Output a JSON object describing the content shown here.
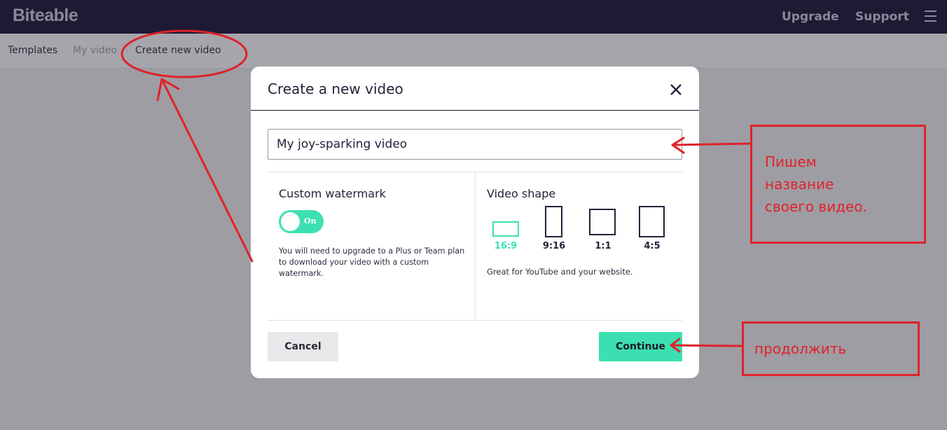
{
  "header": {
    "logo": "Biteable",
    "upgrade_label": "Upgrade",
    "support_label": "Support"
  },
  "subnav": {
    "items": [
      {
        "label": "Templates"
      },
      {
        "label": "My video"
      },
      {
        "label": "Create new video"
      }
    ]
  },
  "modal": {
    "title": "Create a new video",
    "name_input_value": "My joy-sparking video",
    "watermark": {
      "title": "Custom watermark",
      "toggle_label": "On",
      "toggle_state": "on",
      "note": "You will need to upgrade to a Plus or Team plan to download your video with a custom watermark."
    },
    "shape": {
      "title": "Video shape",
      "options": [
        {
          "label": "16:9",
          "selected": true
        },
        {
          "label": "9:16",
          "selected": false
        },
        {
          "label": "1:1",
          "selected": false
        },
        {
          "label": "4:5",
          "selected": false
        }
      ],
      "description": "Great for YouTube and your website."
    },
    "cancel_label": "Cancel",
    "continue_label": "Continue"
  },
  "annotations": {
    "name_note_lines": [
      "Пишем",
      "название",
      "своего видео."
    ],
    "continue_note": "продолжить"
  },
  "colors": {
    "accent": "#3ce0b0",
    "topbar": "#1f1a33",
    "overlay": "#9e9da3",
    "annotation": "#e0222a"
  }
}
